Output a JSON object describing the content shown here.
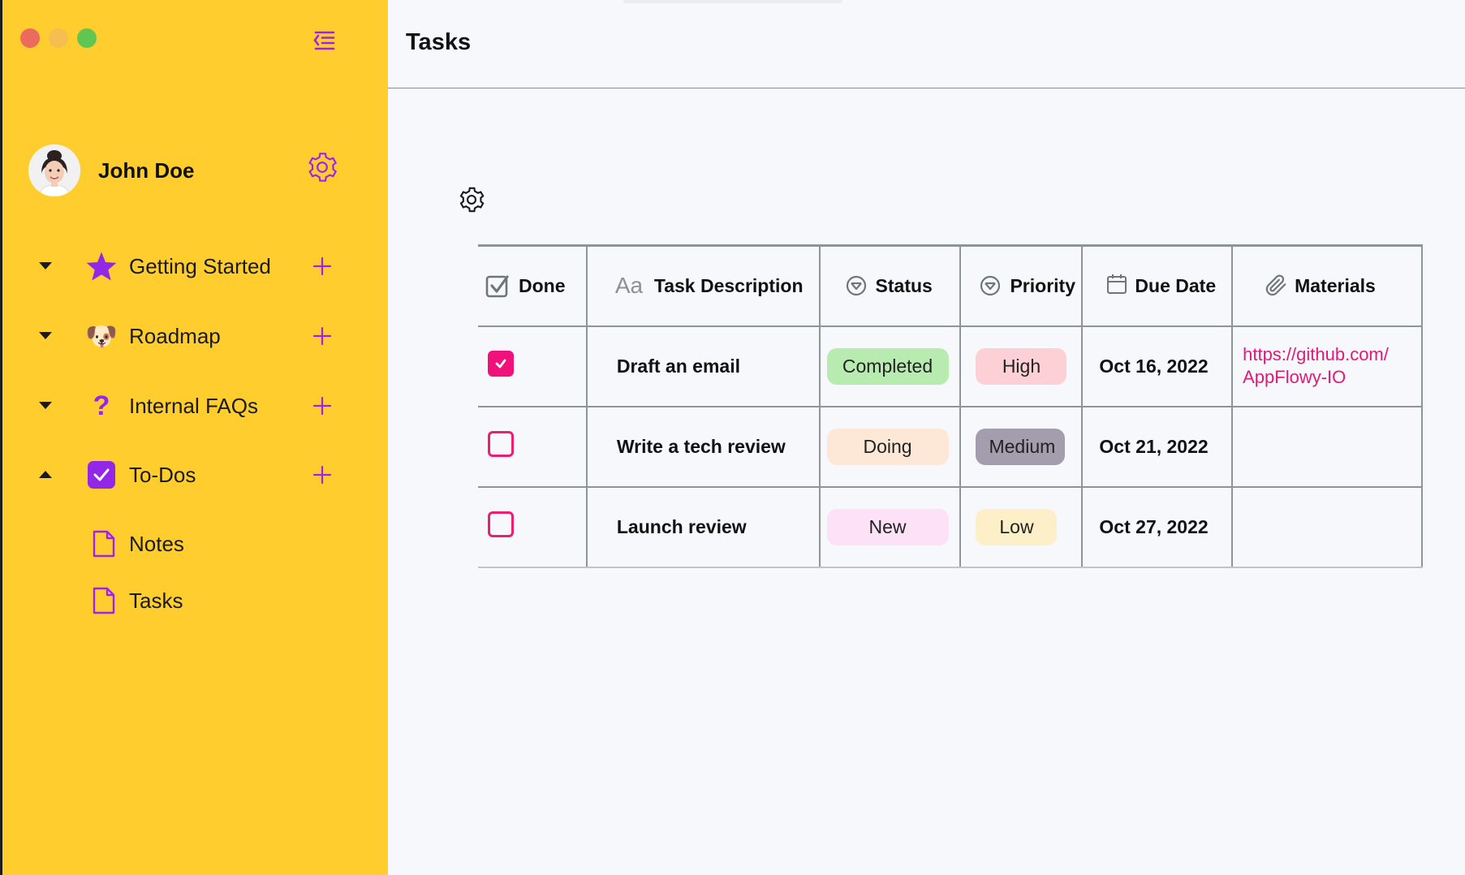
{
  "window": {
    "controls": [
      "close",
      "minimize",
      "maximize"
    ]
  },
  "sidebar": {
    "user": {
      "name": "John Doe"
    },
    "items": [
      {
        "label": "Getting Started",
        "icon": "star-icon",
        "expanded": true
      },
      {
        "label": "Roadmap",
        "icon": "dog-icon",
        "emoji": "🐶",
        "expanded": true
      },
      {
        "label": "Internal FAQs",
        "icon": "question-icon",
        "glyph": "?",
        "expanded": true
      },
      {
        "label": "To-Dos",
        "icon": "checkbox-icon",
        "expanded": false
      }
    ],
    "children": [
      {
        "label": "Notes",
        "icon": "document-icon"
      },
      {
        "label": "Tasks",
        "icon": "document-icon"
      }
    ],
    "accent": "#a020f0",
    "background": "#ffce2e"
  },
  "page": {
    "title": "Tasks"
  },
  "grid": {
    "columns": [
      {
        "label": "Done",
        "icon": "checkbox-icon"
      },
      {
        "label": "Task Description",
        "icon": "text-icon",
        "glyph": "Aa"
      },
      {
        "label": "Status",
        "icon": "select-icon"
      },
      {
        "label": "Priority",
        "icon": "select-icon"
      },
      {
        "label": "Due Date",
        "icon": "calendar-icon"
      },
      {
        "label": "Materials",
        "icon": "paperclip-icon"
      }
    ],
    "rows": [
      {
        "done": true,
        "task": "Draft an email",
        "status": "Completed",
        "priority": "High",
        "due": "Oct 16, 2022",
        "materials_line1": "https://github.com/",
        "materials_line2": "AppFlowy-IO"
      },
      {
        "done": false,
        "task": "Write a tech review",
        "status": "Doing",
        "priority": "Medium",
        "due": "Oct 21, 2022",
        "materials_line1": "",
        "materials_line2": ""
      },
      {
        "done": false,
        "task": "Launch review",
        "status": "New",
        "priority": "Low",
        "due": "Oct 27, 2022",
        "materials_line1": "",
        "materials_line2": ""
      }
    ],
    "colors": {
      "checkbox": "#f0117a",
      "link": "#e2197a",
      "Completed": "#b7ebb0",
      "Doing": "#fde8d8",
      "New": "#fce1f7",
      "High": "#fcd0d4",
      "Medium": "#a39dae",
      "Low": "#fdefc7"
    }
  }
}
